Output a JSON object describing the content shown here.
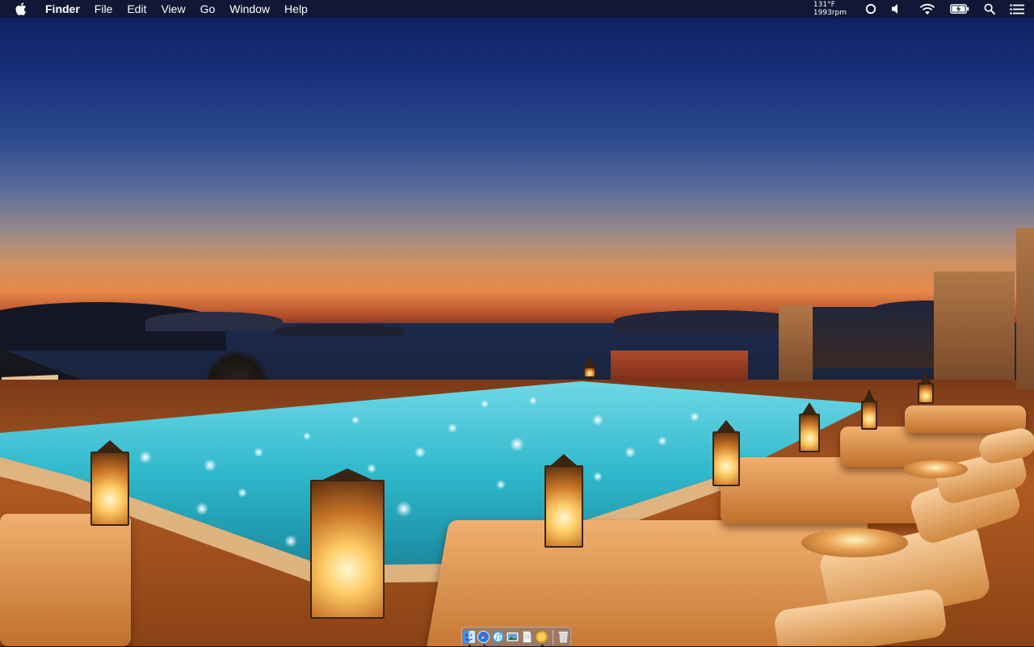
{
  "menubar": {
    "apple_icon": "apple-icon",
    "app_name": "Finder",
    "menus": [
      "File",
      "Edit",
      "View",
      "Go",
      "Window",
      "Help"
    ],
    "sensors": {
      "temperature": "131°F",
      "fan_speed": "1993rpm"
    },
    "status_icons": [
      "record-circle-icon",
      "volume-icon",
      "wifi-icon",
      "battery-charging-icon",
      "spotlight-search-icon",
      "notification-center-icon"
    ]
  },
  "dock": {
    "apps": [
      {
        "name": "finder-icon",
        "running": true,
        "color": "#3a8df0"
      },
      {
        "name": "safari-icon",
        "running": true,
        "color": "#2a78e0"
      },
      {
        "name": "itunes-icon",
        "running": false,
        "color": "#3aa0f0"
      },
      {
        "name": "preview-icon",
        "running": false,
        "color": "#6a9ed8"
      },
      {
        "name": "textedit-icon",
        "running": false,
        "color": "#f4f4f4"
      },
      {
        "name": "system-monitor-icon",
        "running": true,
        "color": "#f0b020"
      }
    ],
    "trash": "trash-icon"
  },
  "wallpaper": {
    "description_colors": {
      "sky_top": "#0d1d5c",
      "horizon": "#e8884a",
      "pool": "#3fd0e0",
      "deck": "#b05a22"
    }
  }
}
